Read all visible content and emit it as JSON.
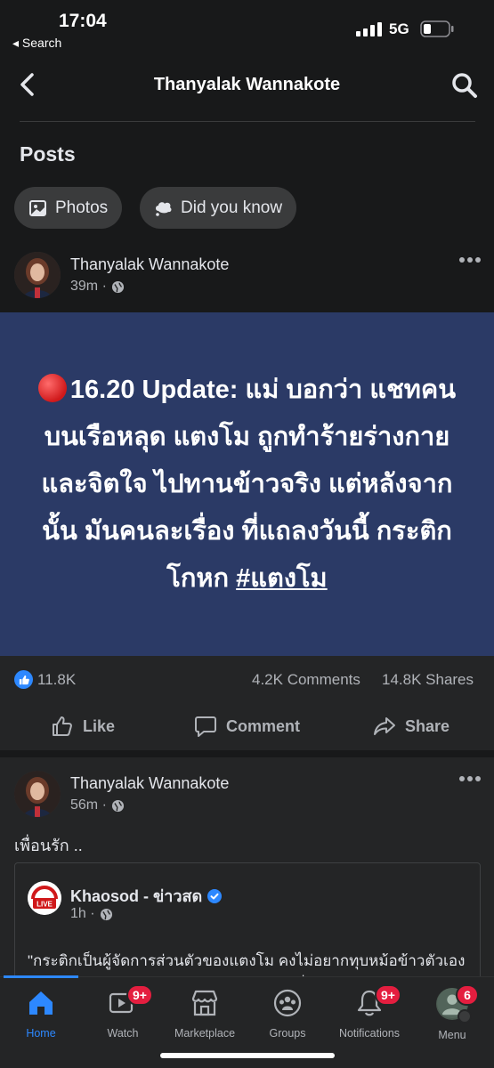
{
  "status": {
    "time": "17:04",
    "back_label": "◂ Search",
    "network": "5G"
  },
  "nav": {
    "title": "Thanyalak Wannakote"
  },
  "section": {
    "title": "Posts"
  },
  "chips": [
    {
      "label": "Photos",
      "icon": "photos-icon"
    },
    {
      "label": "Did you know",
      "icon": "thought-bubble-icon"
    }
  ],
  "post1": {
    "author": "Thanyalak Wannakote",
    "time": "39m ·",
    "banner": {
      "lead": "16.20 Update:",
      "text": " แม่ บอกว่า แชทคนบนเรือหลุด แตงโม ถูกทำร้ายร่างกายและจิตใจ ไปทานข้าวจริง แต่หลังจากนั้น มันคนละเรื่อง ที่แถลงวันนี้ กระติกโกหก ",
      "hashtag": "#แตงโม",
      "background": "#2b3a66"
    },
    "likes": "11.8K",
    "comments": "4.2K Comments",
    "shares": "14.8K Shares"
  },
  "actions": {
    "like": "Like",
    "comment": "Comment",
    "share": "Share"
  },
  "post2": {
    "author": "Thanyalak Wannakote",
    "time": "56m ·",
    "text": "เพื่อนรัก ..",
    "shared": {
      "source": "Khaosod - ข่าวสด",
      "time": "1h ·",
      "body": "\"กระติกเป็นผู้จัดการส่วนตัวของแตงโม คงไม่อยากทุบหม้อข้าวตัวเอง ใครจะหาความลำบากมาให้ตัวเอง เพราะเมื่อไม่มีแตงโม"
    }
  },
  "tabs": [
    {
      "label": "Home",
      "icon": "home-icon",
      "active": true
    },
    {
      "label": "Watch",
      "icon": "watch-icon",
      "badge": "9+"
    },
    {
      "label": "Marketplace",
      "icon": "marketplace-icon"
    },
    {
      "label": "Groups",
      "icon": "groups-icon"
    },
    {
      "label": "Notifications",
      "icon": "bell-icon",
      "badge": "9+"
    },
    {
      "label": "Menu",
      "icon": "menu-avatar-icon",
      "badge": "6"
    }
  ],
  "colors": {
    "accent": "#2d88ff",
    "badge": "#e41e3f",
    "background": "#18191a",
    "card": "#242526"
  }
}
